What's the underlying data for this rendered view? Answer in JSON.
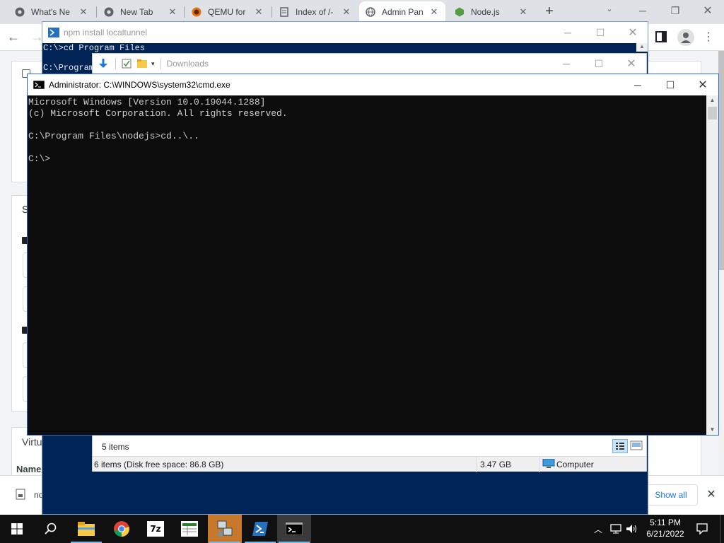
{
  "browser": {
    "tabs": [
      {
        "label": "What's Ne",
        "icon": "chrome-icon"
      },
      {
        "label": "New Tab",
        "icon": "chrome-icon"
      },
      {
        "label": "QEMU for",
        "icon": "qemu-icon"
      },
      {
        "label": "Index of /-",
        "icon": "index-icon"
      },
      {
        "label": "Admin Pan",
        "icon": "globe-icon"
      },
      {
        "label": "Node.js",
        "icon": "nodejs-icon"
      }
    ],
    "new_tab_symbol": "+",
    "partial_labels": {
      "card_heading": "S",
      "section": "Virtu",
      "column": "Name"
    },
    "download_bar": {
      "item_text": "nc",
      "show_all_label": "Show all"
    }
  },
  "npm_window": {
    "title": "npm install localtunnel",
    "lines": [
      "C:\\>cd Program Files",
      "C:\\Program"
    ]
  },
  "explorer": {
    "toolbar_title": "Downloads",
    "status_items": "5 items",
    "details_left": "6 items (Disk free space: 86.8 GB)",
    "details_size": "3.47 GB",
    "details_location": "Computer"
  },
  "cmd": {
    "title": "Administrator: C:\\WINDOWS\\system32\\cmd.exe",
    "lines": [
      "Microsoft Windows [Version 10.0.19044.1288]",
      "(c) Microsoft Corporation. All rights reserved.",
      "",
      "C:\\Program Files\\nodejs>cd..\\..",
      "",
      "C:\\>"
    ]
  },
  "taskbar": {
    "apps": [
      "start-icon",
      "search-icon",
      "file-explorer-icon",
      "chrome-icon",
      "7zip-icon",
      "spreadsheet-icon",
      "network-manager-icon",
      "powershell-icon",
      "cmd-icon"
    ],
    "seven_zip_label": "7z",
    "clock_time": "5:11 PM",
    "clock_date": "6/21/2022"
  },
  "colors": {
    "powershell_bg": "#012456",
    "cmd_bg": "#0c0c0c",
    "taskbar_bg": "#101010",
    "accent": "#1a73e8"
  }
}
